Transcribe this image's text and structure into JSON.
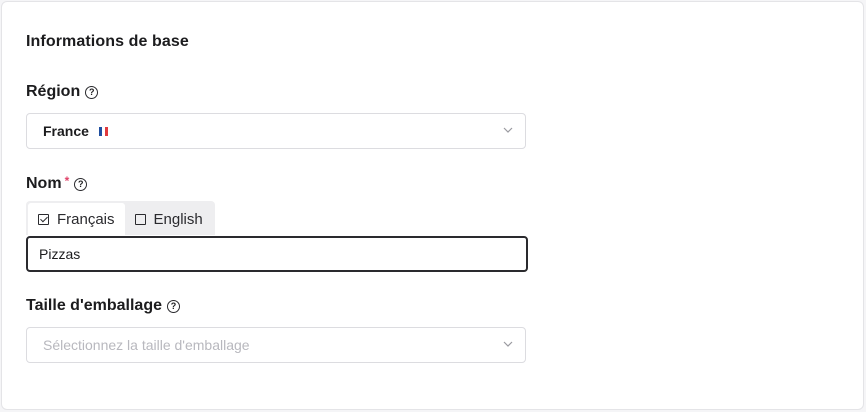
{
  "section": {
    "title": "Informations de base"
  },
  "region": {
    "label": "Région",
    "value": "France",
    "flag_colors": [
      "#1f4fa0",
      "#ffffff",
      "#e03a3e"
    ]
  },
  "name": {
    "label": "Nom",
    "required_mark": "*",
    "tabs": [
      {
        "label": "Français",
        "checked": true
      },
      {
        "label": "English",
        "checked": false
      }
    ],
    "value": "Pizzas"
  },
  "packaging": {
    "label": "Taille d'emballage",
    "placeholder": "Sélectionnez la taille d'emballage"
  },
  "help_icon_glyph": "?"
}
